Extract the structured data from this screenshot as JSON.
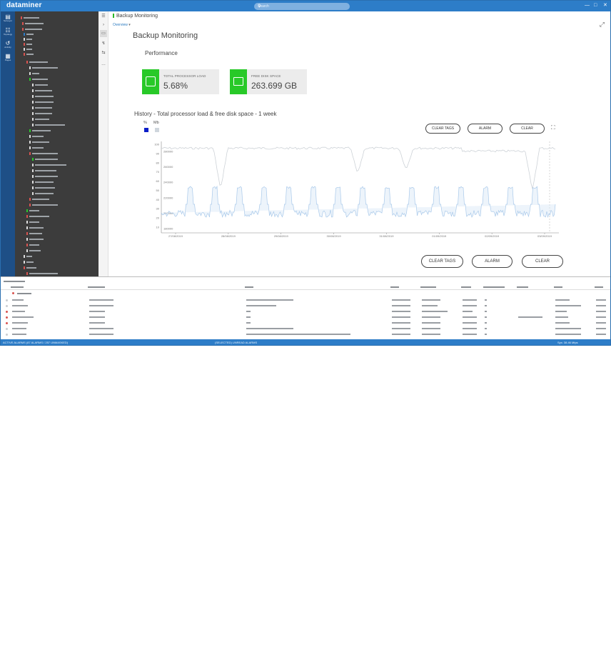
{
  "app": {
    "title": "dataminer",
    "search_placeholder": "Search",
    "window_controls": [
      "—",
      "□",
      "✕"
    ]
  },
  "nav": [
    {
      "label": "Surveyor",
      "icon": "surveyor-icon"
    },
    {
      "label": "Topology",
      "icon": "topology-icon"
    },
    {
      "label": "Activity",
      "icon": "history-icon"
    },
    {
      "label": "Pages",
      "icon": "apps-icon"
    }
  ],
  "card": {
    "breadcrumb": "Backup Monitoring",
    "tab": "Overview",
    "page_title": "Backup Monitoring",
    "section_title": "Performance"
  },
  "kpis": [
    {
      "label": "TOTAL PROCESSOR LOAD",
      "value": "5.68%",
      "icon": "cpu-icon",
      "color": "#28c928"
    },
    {
      "label": "FREE DISK SPACE",
      "value": "263.699 GB",
      "icon": "disk-icon",
      "color": "#28c928"
    }
  ],
  "history": {
    "title": "History - Total processor load & free disk space - 1 week",
    "unit_left": "%",
    "unit_right": "Mb",
    "buttons_top": [
      "CLEAR TAGS",
      "ALARM",
      "CLEAR"
    ],
    "buttons_bottom": [
      "CLEAR TAGS",
      "ALARM",
      "CLEAR"
    ]
  },
  "chart_data": {
    "type": "line",
    "title": "History - Total processor load & free disk space - 1 week",
    "xlabel": "",
    "ylabel": "",
    "y_left_ticks": [
      100,
      90,
      80,
      70,
      60,
      50,
      40,
      30,
      20,
      10
    ],
    "y_right_ticks": [
      280000,
      260000,
      240000,
      220000,
      200000,
      180000
    ],
    "x_ticks": [
      "27/08/2019",
      "28/08/2019",
      "29/08/2019",
      "30/08/2019",
      "31/08/2019",
      "01/09/2019",
      "02/09/2019",
      "03/09/2019"
    ],
    "series": [
      {
        "name": "%",
        "color": "#a9c9ea",
        "pattern": "daily spikes to ~40% from ~8% baseline"
      },
      {
        "name": "Mb",
        "color": "#d2d6da",
        "pattern": "near 270000 with drops to ~200000"
      }
    ],
    "grid": false,
    "legend": "top-left"
  },
  "alarms": {
    "header_label": "ACTIVE ALARMS",
    "rows": 8
  },
  "status": {
    "left": "ACTIVE ALARMS (87 ALARMS / 257 UNMASKED)",
    "center": "(SELECTED) UNREAD ALARMS",
    "right": "Sys: 38.46 Mtps"
  }
}
